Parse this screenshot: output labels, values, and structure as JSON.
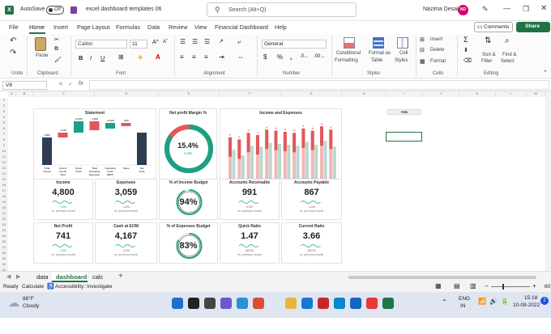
{
  "titlebar": {
    "autosave": "AutoSave",
    "toggle": "Off",
    "filename": "excel dashboard templates 06",
    "search_placeholder": "Search (Alt+Q)",
    "user": "Nazima Desai",
    "initials": "ND"
  },
  "menu": {
    "items": [
      "File",
      "Home",
      "Insert",
      "Page Layout",
      "Formulas",
      "Data",
      "Review",
      "View",
      "Financial Dashboard",
      "Help"
    ],
    "comments": "Comments",
    "share": "Share"
  },
  "ribbon": {
    "undo": "Undo",
    "paste": "Paste",
    "clipboard": "Clipboard",
    "font_name": "Calibri",
    "font_size": "11",
    "font": "Font",
    "alignment": "Alignment",
    "number_format": "General",
    "number": "Number",
    "cond_format_1": "Conditional",
    "cond_format_2": "Formatting",
    "format_table_1": "Format as",
    "format_table_2": "Table",
    "cell_styles_1": "Cell",
    "cell_styles_2": "Styles",
    "styles": "Styles",
    "insert": "Insert",
    "delete": "Delete",
    "format": "Format",
    "cells": "Cells",
    "sort_1": "Sort &",
    "sort_2": "Filter",
    "find_1": "Find &",
    "find_2": "Select",
    "editing": "Editing",
    "sigma": "Σ"
  },
  "formula_bar": {
    "name_box": "V8",
    "fx": "fx",
    "formula": ""
  },
  "columns": [
    "A",
    "B",
    "C",
    "D",
    "E",
    "F",
    "G",
    "H",
    "I",
    "J",
    "K",
    "L",
    "M",
    "N"
  ],
  "rows": [
    "1",
    "2",
    "3",
    "4",
    "5",
    "6",
    "7",
    "8",
    "9",
    "10",
    "11",
    "12",
    "13",
    "14",
    "15",
    "16",
    "17",
    "18",
    "19",
    "20",
    "21",
    "22",
    "23",
    "24",
    "25",
    "26",
    "27",
    "28",
    "29",
    "30",
    "31"
  ],
  "dashboard": {
    "statement": {
      "title": "Statement",
      "categories": [
        "Total Income",
        "Cost of Goods Sold",
        "Gross Profit",
        "Total Operating Expenses",
        "Operating Profit (EBIT)",
        "Taxes",
        "Net Profit"
      ],
      "labels": [
        "4,800",
        "-1,115",
        "+3,059",
        "-1,849",
        "+1,000",
        "-350",
        "-"
      ]
    },
    "net_profit_margin": {
      "title": "Net profit Margin %",
      "value": "15.4%",
      "sub": "1.4%"
    },
    "income_expenses": {
      "title": "Income and Expenses"
    },
    "feb_label": "FEB",
    "kpis_top": [
      {
        "title": "Income",
        "value": "4,800",
        "pct": "0.0%",
        "sub": "vs. previous month",
        "good": true
      },
      {
        "title": "Expenses",
        "value": "3,059",
        "pct": "-1.5%",
        "sub": "vs. previous month",
        "good": false
      },
      {
        "title": "% of Income Budget",
        "value": "94%"
      },
      {
        "title": "Accounts Receivable",
        "value": "991",
        "pct": "0.0%",
        "sub": "vs. previous month",
        "good": false
      },
      {
        "title": "Accounts Payable",
        "value": "867",
        "pct": "-1.5%",
        "sub": "vs. previous month",
        "good": false
      }
    ],
    "kpis_bottom": [
      {
        "title": "Net Profit",
        "value": "741",
        "pct": "2.3%",
        "sub": "vs. previous month",
        "good": true
      },
      {
        "title": "Cash at EOM",
        "value": "4,167",
        "pct": "-0.4%",
        "sub": "vs. previous month",
        "good": false
      },
      {
        "title": "% of Expenses Budget",
        "value": "83%"
      },
      {
        "title": "Quick Ratio",
        "value": "1.47",
        "pct": "98.0%",
        "sub": "vs. previous month",
        "good": false
      },
      {
        "title": "Current Ratio",
        "value": "3.66",
        "pct": "98.0%",
        "sub": "vs. previous month",
        "good": false
      }
    ],
    "income_gauge_fraction": 0.94,
    "expense_gauge_fraction": 0.83,
    "margin_gauge_fraction": 0.154
  },
  "sheets": {
    "tabs": [
      "data",
      "dashboard",
      "calc"
    ],
    "active": "dashboard",
    "add": "+"
  },
  "status": {
    "ready": "Ready",
    "calculate": "Calculate",
    "accessibility": "Accessibility: Investigate",
    "zoom": "60"
  },
  "taskbar": {
    "temp": "88°F",
    "weather": "Cloudy",
    "lang1": "ENG",
    "lang2": "IN",
    "time": "15:18",
    "date": "10-09-2022",
    "notif": "2"
  },
  "colors": {
    "excel_green": "#217346",
    "teal": "#1aa184",
    "red": "#e2575a",
    "navy": "#2f3d52"
  }
}
